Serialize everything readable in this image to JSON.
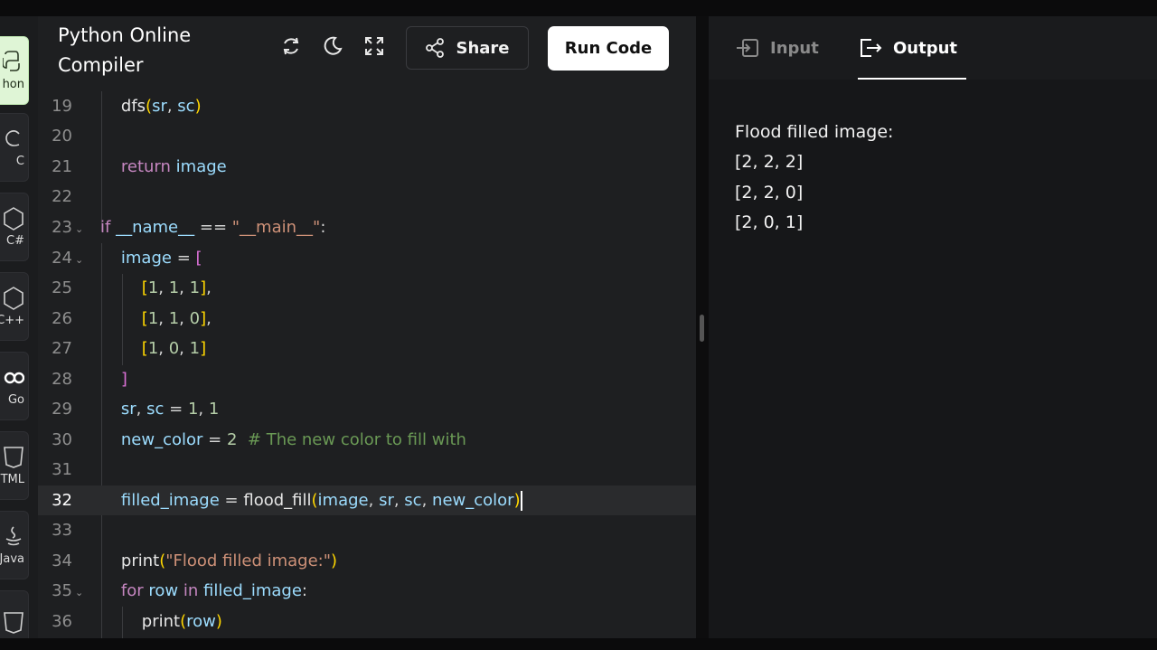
{
  "app": {
    "title": "Python Online Compiler"
  },
  "rail": {
    "languages": [
      {
        "label": "hon",
        "icon": "python-icon",
        "active": true
      },
      {
        "label": "C",
        "icon": "c-icon",
        "active": false
      },
      {
        "label": "C#",
        "icon": "csharp-icon",
        "active": false
      },
      {
        "label": "C++",
        "icon": "cpp-icon",
        "active": false
      },
      {
        "label": "Go",
        "icon": "go-icon",
        "active": false
      },
      {
        "label": "HTML",
        "icon": "html-icon",
        "active": false
      },
      {
        "label": "Java",
        "icon": "java-icon",
        "active": false
      },
      {
        "label": "",
        "icon": "js-icon",
        "active": false
      }
    ]
  },
  "toolbar": {
    "share_label": "Share",
    "run_label": "Run Code",
    "icons": [
      "refresh-icon",
      "dark-mode-icon",
      "fullscreen-icon",
      "share-icon"
    ]
  },
  "editor": {
    "current_line": 32,
    "lines": [
      {
        "n": "19",
        "text": "    dfs(sr, sc)"
      },
      {
        "n": "20",
        "text": ""
      },
      {
        "n": "21",
        "text": "    return image"
      },
      {
        "n": "22",
        "text": ""
      },
      {
        "n": "23",
        "text": "if __name__ == \"__main__\":",
        "fold": true
      },
      {
        "n": "24",
        "text": "    image = [",
        "fold": true
      },
      {
        "n": "25",
        "text": "        [1, 1, 1],"
      },
      {
        "n": "26",
        "text": "        [1, 1, 0],"
      },
      {
        "n": "27",
        "text": "        [1, 0, 1]"
      },
      {
        "n": "28",
        "text": "    ]"
      },
      {
        "n": "29",
        "text": "    sr, sc = 1, 1"
      },
      {
        "n": "30",
        "text": "    new_color = 2  # The new color to fill with"
      },
      {
        "n": "31",
        "text": ""
      },
      {
        "n": "32",
        "text": "    filled_image = flood_fill(image, sr, sc, new_color)"
      },
      {
        "n": "33",
        "text": ""
      },
      {
        "n": "34",
        "text": "    print(\"Flood filled image:\")"
      },
      {
        "n": "35",
        "text": "    for row in filled_image:",
        "fold": true
      },
      {
        "n": "36",
        "text": "        print(row)"
      }
    ]
  },
  "panel": {
    "tabs": [
      {
        "label": "Input",
        "icon": "input-icon",
        "active": false
      },
      {
        "label": "Output",
        "icon": "output-icon",
        "active": true
      }
    ],
    "output_lines": [
      "Flood filled image:",
      "[2, 2, 2]",
      "[2, 2, 0]",
      "[2, 0, 1]"
    ]
  },
  "colors": {
    "accent_active_lang": "#dff5d6",
    "run_button": "#ffffff",
    "editor_bg": "#1e1f21",
    "output_bg": "#161719"
  }
}
